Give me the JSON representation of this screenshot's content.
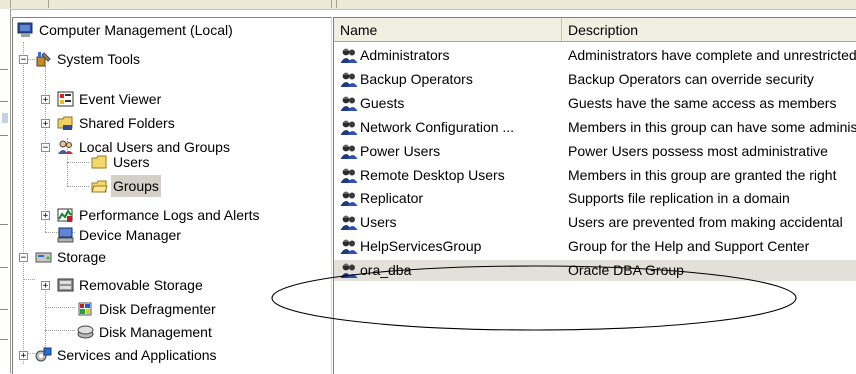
{
  "tree": {
    "root": "Computer Management (Local)",
    "system_tools": "System Tools",
    "event_viewer": "Event Viewer",
    "shared_folders": "Shared Folders",
    "local_users_groups": "Local Users and Groups",
    "users": "Users",
    "groups": "Groups",
    "perf_logs": "Performance Logs and Alerts",
    "device_manager": "Device Manager",
    "storage": "Storage",
    "removable_storage": "Removable Storage",
    "disk_defrag": "Disk Defragmenter",
    "disk_mgmt": "Disk Management",
    "services_apps": "Services and Applications",
    "selected": "groups"
  },
  "list": {
    "columns": [
      "Name",
      "Description"
    ],
    "rows": [
      {
        "name": "Administrators",
        "description": "Administrators have complete and unrestricted"
      },
      {
        "name": "Backup Operators",
        "description": "Backup Operators can override security"
      },
      {
        "name": "Guests",
        "description": "Guests have the same access as members"
      },
      {
        "name": "Network Configuration ...",
        "description": "Members in this group can have some administrative"
      },
      {
        "name": "Power Users",
        "description": "Power Users possess most administrative"
      },
      {
        "name": "Remote Desktop Users",
        "description": "Members in this group are granted the right"
      },
      {
        "name": "Replicator",
        "description": "Supports file replication in a domain"
      },
      {
        "name": "Users",
        "description": "Users are prevented from making accidental"
      },
      {
        "name": "HelpServicesGroup",
        "description": "Group for the Help and Support Center"
      },
      {
        "name": "ora_dba",
        "description": "Oracle DBA Group"
      }
    ],
    "highlighted_row": "ora_dba"
  },
  "icons": {
    "computer": "computer-icon",
    "tools": "system-tools-icon",
    "event": "event-viewer-icon",
    "shared": "shared-folder-icon",
    "users": "users-group-icon",
    "folder": "folder-icon",
    "perf": "performance-icon",
    "device": "device-manager-icon",
    "storage": "storage-icon",
    "removable": "removable-storage-icon",
    "defrag": "defragmenter-icon",
    "disk": "disk-management-icon",
    "services": "services-icon",
    "group": "group-icon"
  },
  "colors": {
    "selection": "#d4d0c8",
    "annotation": "#000000",
    "header_bg": "#f1efe2"
  }
}
